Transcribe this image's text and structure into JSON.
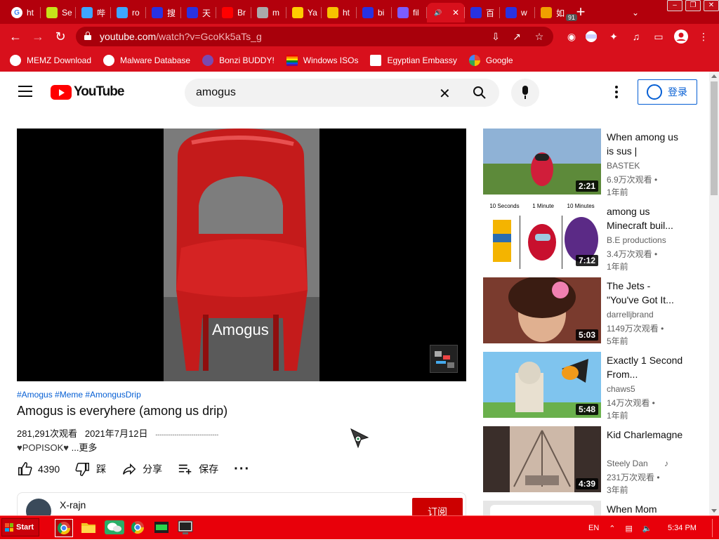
{
  "browser": {
    "tabs": [
      {
        "label": "ht",
        "icon": "google-icon",
        "color": "#ffffff"
      },
      {
        "label": "Se",
        "icon": "leaf-icon",
        "color": "#c6e31a"
      },
      {
        "label": "哔",
        "icon": "bilibili-icon",
        "color": "#3ea6ff"
      },
      {
        "label": "ro",
        "icon": "bilibili-icon",
        "color": "#3ea6ff"
      },
      {
        "label": "搜",
        "icon": "baidu-icon",
        "color": "#2932e1"
      },
      {
        "label": "天",
        "icon": "baidu-icon",
        "color": "#2932e1"
      },
      {
        "label": "Br",
        "icon": "youtube-icon",
        "color": "#ff0000"
      },
      {
        "label": "m",
        "icon": "loading-icon",
        "color": "#aaaaaa"
      },
      {
        "label": "Ya",
        "icon": "yandex-icon",
        "color": "#ffcc00"
      },
      {
        "label": "ht",
        "icon": "smiley-icon",
        "color": "#f7c200"
      },
      {
        "label": "bi",
        "icon": "baidu-icon",
        "color": "#2932e1"
      },
      {
        "label": "fil",
        "icon": "file-icon",
        "color": "#7b5cff"
      },
      {
        "label": "",
        "icon": "speaker-icon",
        "color": "#ffffff",
        "active": true
      },
      {
        "label": "百",
        "icon": "baidu-icon",
        "color": "#2932e1"
      },
      {
        "label": "w",
        "icon": "baidu-icon",
        "color": "#2932e1"
      },
      {
        "label": "如",
        "icon": "s-icon",
        "color": "#f0a000"
      }
    ],
    "new_tab": "+",
    "tab_search": "⌄",
    "window_buttons": [
      "–",
      "❐",
      "✕"
    ],
    "url_host": "youtube.com",
    "url_path": "/watch?v=GcoKk5aTs_g",
    "extension_badge": "91",
    "bookmarks": [
      {
        "label": "MEMZ Download",
        "icon": "globe-icon",
        "color": "#ffffff"
      },
      {
        "label": "Malware Database",
        "icon": "globe-icon",
        "color": "#ffffff"
      },
      {
        "label": "Bonzi BUDDY!",
        "icon": "bonzi-icon",
        "color": "#7a4ab0"
      },
      {
        "label": "Windows ISOs",
        "icon": "rainbow-flag-icon",
        "color": "#ff8800"
      },
      {
        "label": "Egyptian Embassy",
        "icon": "wix-icon",
        "color": "#ffffff"
      },
      {
        "label": "Google",
        "icon": "google-icon",
        "color": "#ffffff"
      }
    ]
  },
  "youtube": {
    "logo_text": "YouTube",
    "search_query": "amogus",
    "signin_label": "登录",
    "video_overlay_text": "Amogus",
    "hashtags": "#Amogus #Meme #AmongusDrip",
    "title": "Amogus is everyhere (among us drip)",
    "views": "281,291次观看",
    "date": "2021年7月12日",
    "date_rule": "------------------------------",
    "description": "♥POPISOK♥",
    "more_label": "...更多",
    "likes": "4390",
    "dislike_label": "踩",
    "share_label": "分享",
    "save_label": "保存",
    "channel_name": "X-rajn",
    "subscribe_label": "订阅"
  },
  "recommendations": [
    {
      "title": "When among us is sus |",
      "channel": "BASTEK",
      "views": "6.9万次观看 •",
      "age": "1年前",
      "duration": "2:21",
      "music": false
    },
    {
      "title": "among us Minecraft buil...",
      "channel": "B.E productions",
      "views": "3.4万次观看 •",
      "age": "1年前",
      "duration": "7:12",
      "music": false
    },
    {
      "title": "The Jets - \"You've Got It...",
      "channel": "darrelljbrand",
      "views": "1149万次观看 •",
      "age": "5年前",
      "duration": "5:03",
      "music": false
    },
    {
      "title": "Exactly 1 Second From...",
      "channel": "chaws5",
      "views": "14万次观看 •",
      "age": "1年前",
      "duration": "5:48",
      "music": false
    },
    {
      "title": "Kid Charlemagne",
      "channel": "Steely Dan",
      "views": "231万次观看 •",
      "age": "3年前",
      "duration": "4:39",
      "music": true
    },
    {
      "title": "When Mom",
      "channel": "",
      "views": "",
      "age": "",
      "duration": "",
      "music": false
    }
  ],
  "thumb2_labels": [
    "10 Seconds",
    "1 Minute",
    "10 Minutes"
  ],
  "taskbar": {
    "start_label": "Start",
    "language": "EN",
    "time": "5:34 PM"
  }
}
